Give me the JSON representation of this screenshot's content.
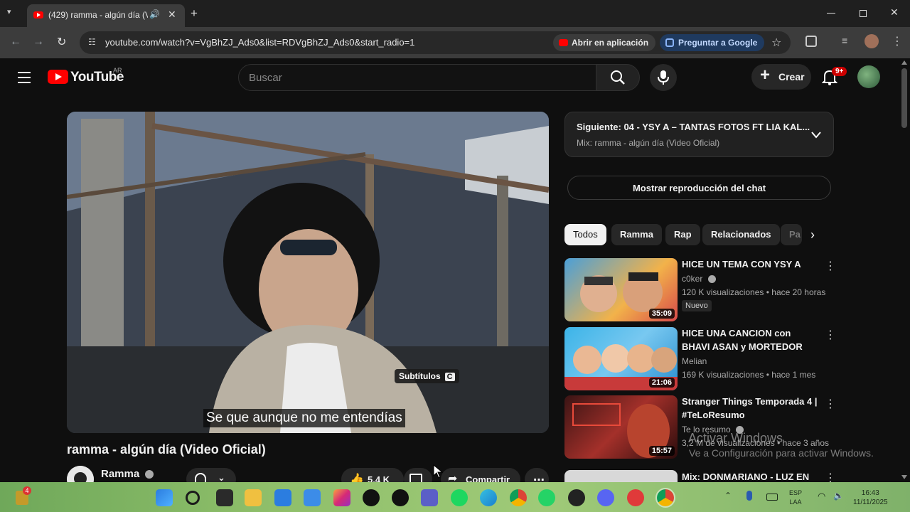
{
  "browser": {
    "tab_title": "(429) ramma - algún día (Vi",
    "url": "youtube.com/watch?v=VgBhZJ_Ads0&list=RDVgBhZJ_Ads0&start_radio=1",
    "open_in_app_label": "Abrir en aplicación",
    "ask_google_label": "Preguntar a Google"
  },
  "youtube": {
    "logo_text": "YouTube",
    "region": "AR",
    "search_placeholder": "Buscar",
    "create_label": "Crear",
    "notifications_badge": "9+"
  },
  "player": {
    "subtitle_text": "Se que aunque no me entendías",
    "cc_hint_label": "Subtítulos",
    "cc_hint_key": "C"
  },
  "video": {
    "title": "ramma - algún día (Video Oficial)",
    "channel": "Ramma",
    "likes": "5,4 K",
    "share_label": "Compartir"
  },
  "up_next": {
    "title": "Siguiente: 04 - YSY A – TANTAS FOTOS FT LIA KAL...",
    "subtitle": "Mix: ramma - algún día (Video Oficial)"
  },
  "chat_replay_label": "Mostrar reproducción del chat",
  "filters": [
    "Todos",
    "Ramma",
    "Rap",
    "Relacionados",
    "Pa"
  ],
  "related": [
    {
      "title": "HICE UN TEMA CON YSY A",
      "channel": "c0ker",
      "meta": "120 K visualizaciones • hace 20 horas",
      "badge": "Nuevo",
      "duration": "35:09"
    },
    {
      "title": "HICE UNA CANCION con BHAVI ASAN y MORTEDOR",
      "channel": "Melian",
      "meta": "169 K visualizaciones • hace 1 mes",
      "duration": "21:06"
    },
    {
      "title": "Stranger Things Temporada 4 | #TeLoResumo",
      "channel": "Te lo resumo",
      "meta": "3,2 M de visualizaciones • hace 3 años",
      "duration": "15:57"
    },
    {
      "title": "Mix: DONMARIANO - LUZ EN LA"
    }
  ],
  "windows_watermark": {
    "line1": "Activar Windows",
    "line2": "Ve a Configuración para activar Windows."
  },
  "taskbar": {
    "widget_badge": "4",
    "lang_line1": "ESP",
    "lang_line2": "LAA",
    "time": "16:43",
    "date": "11/11/2025"
  },
  "colors": {
    "youtube_red": "#ff0000",
    "background": "#0f0f0f",
    "surface": "#272727",
    "accent_blue": "#c2d9ff"
  }
}
